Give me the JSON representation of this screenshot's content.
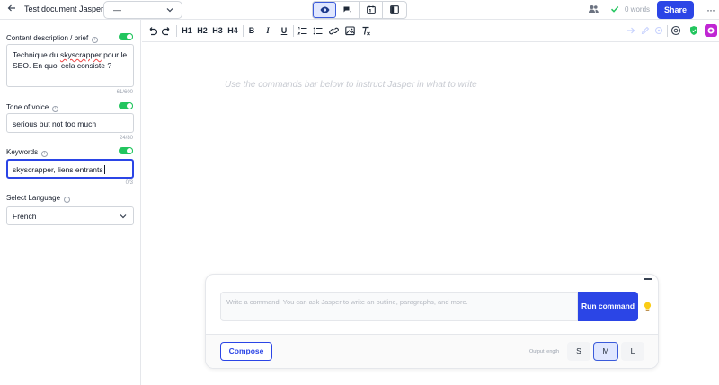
{
  "topbar": {
    "doc_title": "Test document Jasper",
    "preset_value": "—",
    "word_count": "0 words",
    "share_label": "Share"
  },
  "sidebar": {
    "brief": {
      "label": "Content description / brief",
      "value_part1": "Technique du ",
      "value_misspelled": "skyscrapper",
      "value_part2": " pour le SEO. En quoi cela consiste ?",
      "counter": "61/600"
    },
    "tone": {
      "label": "Tone of voice",
      "value": "serious but not too much",
      "counter": "24/80"
    },
    "keywords": {
      "label": "Keywords",
      "value": "skyscrapper, liens entrants",
      "counter": "0/3"
    },
    "language": {
      "label": "Select Language",
      "value": "French"
    }
  },
  "toolbar": {
    "h1": "H1",
    "h2": "H2",
    "h3": "H3",
    "h4": "H4",
    "bold": "B",
    "italic": "I",
    "underline": "U"
  },
  "editor": {
    "placeholder": "Use the commands bar below to instruct Jasper in what to write"
  },
  "command": {
    "placeholder": "Write a command. You can ask Jasper to write an outline, paragraphs, and more.",
    "run_label": "Run command",
    "compose_label": "Compose",
    "length_label": "Output length",
    "sizes": [
      "S",
      "M",
      "L"
    ]
  },
  "colors": {
    "accent": "#2b45e6",
    "toggle_on": "#22c55e",
    "badge_pink": "#c026d3"
  }
}
